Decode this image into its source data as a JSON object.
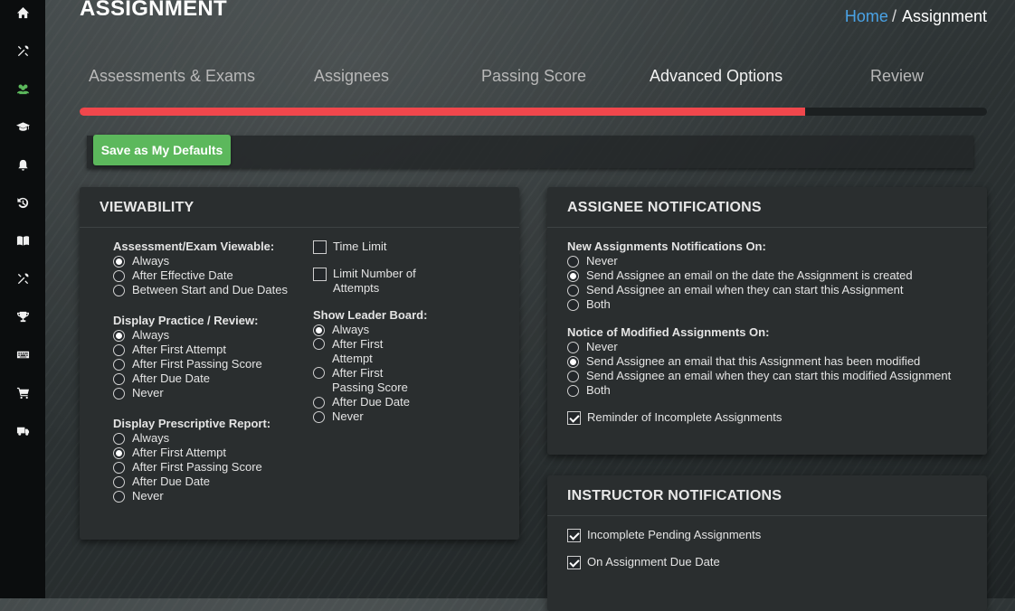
{
  "header": {
    "title": "ASSIGNMENT",
    "breadcrumb": {
      "home": "Home",
      "separator": "/",
      "current": "Assignment"
    }
  },
  "sidebar": {
    "items": [
      {
        "icon": "home-icon"
      },
      {
        "icon": "tools-icon"
      },
      {
        "icon": "users-icon",
        "active": true
      },
      {
        "icon": "graduation-cap-icon"
      },
      {
        "icon": "bell-icon"
      },
      {
        "icon": "history-icon"
      },
      {
        "icon": "book-icon"
      },
      {
        "icon": "wrench-icon"
      },
      {
        "icon": "trophy-icon"
      },
      {
        "icon": "keyboard-icon"
      },
      {
        "icon": "cart-icon"
      },
      {
        "icon": "truck-icon"
      }
    ]
  },
  "tabs": [
    {
      "label": "Assessments & Exams"
    },
    {
      "label": "Assignees"
    },
    {
      "label": "Passing Score"
    },
    {
      "label": "Advanced Options",
      "current": true
    },
    {
      "label": "Review"
    }
  ],
  "progress": {
    "percent": 80
  },
  "defaults_button": {
    "label": "Save as My Defaults",
    "color": "#5cb85c"
  },
  "accent_color": "#f0474c",
  "viewability": {
    "title": "VIEWABILITY",
    "exam_viewable": {
      "label": "Assessment/Exam Viewable:",
      "options": [
        "Always",
        "After Effective Date",
        "Between Start and Due Dates"
      ],
      "selected": 0
    },
    "practice_review": {
      "label": "Display Practice / Review:",
      "options": [
        "Always",
        "After First Attempt",
        "After First Passing Score",
        "After Due Date",
        "Never"
      ],
      "selected": 0
    },
    "prescriptive": {
      "label": "Display Prescriptive Report:",
      "options": [
        "Always",
        "After First Attempt",
        "After First Passing Score",
        "After Due Date",
        "Never"
      ],
      "selected": 1
    },
    "time_limit": {
      "label": "Time Limit",
      "checked": false
    },
    "limit_attempts": {
      "label": "Limit Number of Attempts",
      "checked": false
    },
    "leader_board": {
      "label": "Show Leader Board:",
      "options": [
        "Always",
        "After First Attempt",
        "After First Passing Score",
        "After Due Date",
        "Never"
      ],
      "selected": 0
    }
  },
  "assignee_notifications": {
    "title": "ASSIGNEE NOTIFICATIONS",
    "new_assignments": {
      "label": "New Assignments Notifications On:",
      "options": [
        "Never",
        "Send Assignee an email on the date the Assignment is created",
        "Send Assignee an email when they can start this Assignment",
        "Both"
      ],
      "selected": 1
    },
    "modified": {
      "label": "Notice of Modified Assignments On:",
      "options": [
        "Never",
        "Send Assignee an email that this Assignment has been modified",
        "Send Assignee an email when they can start this modified Assignment",
        "Both"
      ],
      "selected": 1
    },
    "reminder": {
      "label": "Reminder of Incomplete Assignments",
      "checked": true
    }
  },
  "instructor_notifications": {
    "title": "INSTRUCTOR NOTIFICATIONS",
    "incomplete_pending": {
      "label": "Incomplete Pending Assignments",
      "checked": true
    },
    "due_date": {
      "label": "On Assignment Due Date",
      "checked": true
    }
  }
}
